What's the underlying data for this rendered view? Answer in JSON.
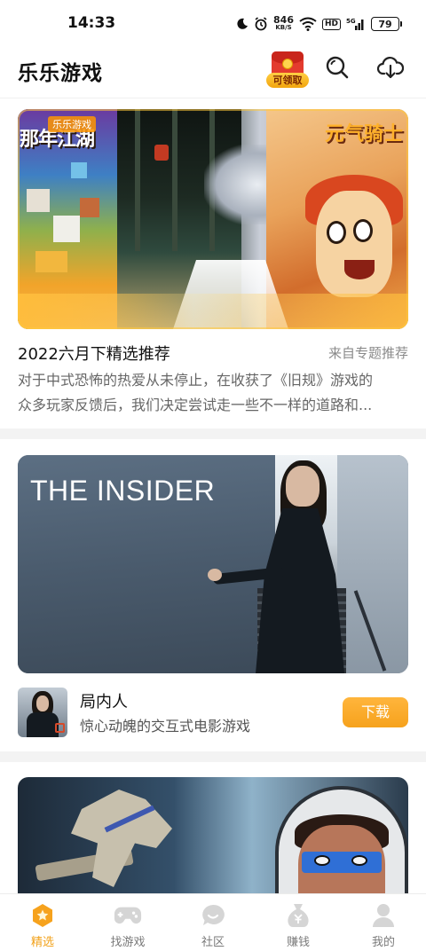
{
  "status_bar": {
    "time": "14:33",
    "net_speed_value": "846",
    "net_speed_unit": "KB/S",
    "hd_label": "HD",
    "signal_label": "5G",
    "battery": "79",
    "icons": [
      "moon-icon",
      "alarm-icon",
      "wifi-icon",
      "hd-icon",
      "signal-5g-icon",
      "battery-icon"
    ]
  },
  "header": {
    "title": "乐乐游戏",
    "redpacket_label": "可领取",
    "icons": [
      "red-packet-icon",
      "search-icon",
      "cloud-download-icon"
    ]
  },
  "feed": {
    "cards": [
      {
        "banner": {
          "tag": "乐乐游戏",
          "left_text": "那年江湖",
          "right_text": "元气骑士"
        },
        "title": "2022六月下精选推荐",
        "source": "来自专题推荐",
        "desc_lines": [
          "对于中式恐怖的热爱从未停止，在收获了《旧规》游戏的",
          "众多玩家反馈后，我们决定尝试走一些不一样的道路和..."
        ]
      },
      {
        "banner": {
          "title": "THE INSIDER"
        },
        "game_name": "局内人",
        "tagline": "惊心动魄的交互式电影游戏",
        "action_label": "下载"
      }
    ]
  },
  "bottom_nav": {
    "items": [
      {
        "label": "精选",
        "icon": "star-hexagon-icon",
        "active": true
      },
      {
        "label": "找游戏",
        "icon": "gamepad-icon",
        "active": false
      },
      {
        "label": "社区",
        "icon": "chat-bubble-icon",
        "active": false
      },
      {
        "label": "赚钱",
        "icon": "money-bag-icon",
        "active": false
      },
      {
        "label": "我的",
        "icon": "person-icon",
        "active": false
      }
    ]
  },
  "colors": {
    "accent": "#f6a21d",
    "text_primary": "#111111",
    "text_secondary": "#666666",
    "separator": "#f3f3f3"
  }
}
